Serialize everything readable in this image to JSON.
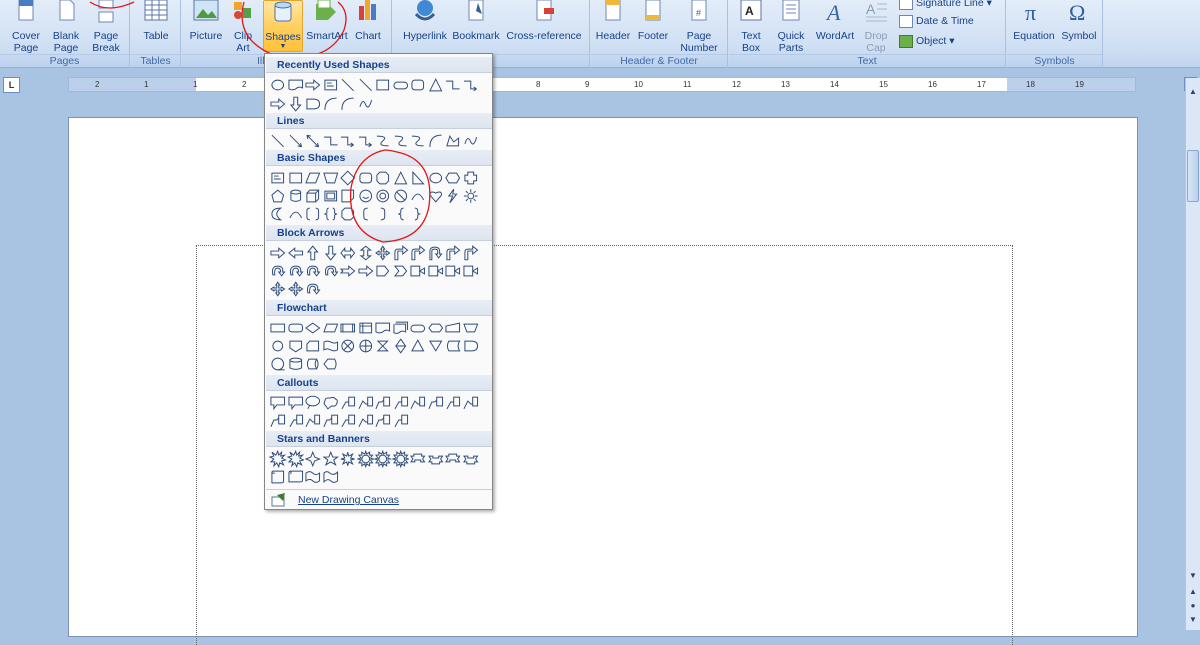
{
  "ribbon": {
    "pages": {
      "label": "Pages",
      "cover_page": "Cover\nPage",
      "blank_page": "Blank\nPage",
      "page_break": "Page\nBreak"
    },
    "tables": {
      "label": "Tables",
      "table": "Table"
    },
    "illustrations": {
      "label": "Ill",
      "picture": "Picture",
      "clip_art": "Clip\nArt",
      "shapes": "Shapes",
      "smartart": "SmartArt",
      "chart": "Chart"
    },
    "links": {
      "label": "ks",
      "hyperlink": "Hyperlink",
      "bookmark": "Bookmark",
      "cross_reference": "Cross-reference"
    },
    "header_footer": {
      "label": "Header & Footer",
      "header": "Header",
      "footer": "Footer",
      "page_number": "Page\nNumber"
    },
    "text": {
      "label": "Text",
      "text_box": "Text\nBox",
      "quick_parts": "Quick\nParts",
      "wordart": "WordArt",
      "drop_cap": "Drop\nCap",
      "signature_line": "Signature Line",
      "date_time": "Date & Time",
      "object": "Object"
    },
    "symbols": {
      "label": "Symbols",
      "equation": "Equation",
      "symbol": "Symbol"
    }
  },
  "ruler": {
    "corner": "L",
    "ticks": [
      "2",
      "1",
      "1",
      "2",
      "3",
      "4",
      "5",
      "6",
      "7",
      "8",
      "9",
      "10",
      "11",
      "12",
      "13",
      "14",
      "15",
      "16",
      "17",
      "18",
      "19"
    ]
  },
  "shapes_menu": {
    "recently_used": "Recently Used Shapes",
    "lines": "Lines",
    "basic_shapes": "Basic Shapes",
    "block_arrows": "Block Arrows",
    "flowchart": "Flowchart",
    "callouts": "Callouts",
    "stars_banners": "Stars and Banners",
    "new_canvas": "New Drawing Canvas"
  },
  "colors": {
    "ribbon_text": "#15428b",
    "highlight": "#ffd060",
    "annotation": "#e01818"
  }
}
